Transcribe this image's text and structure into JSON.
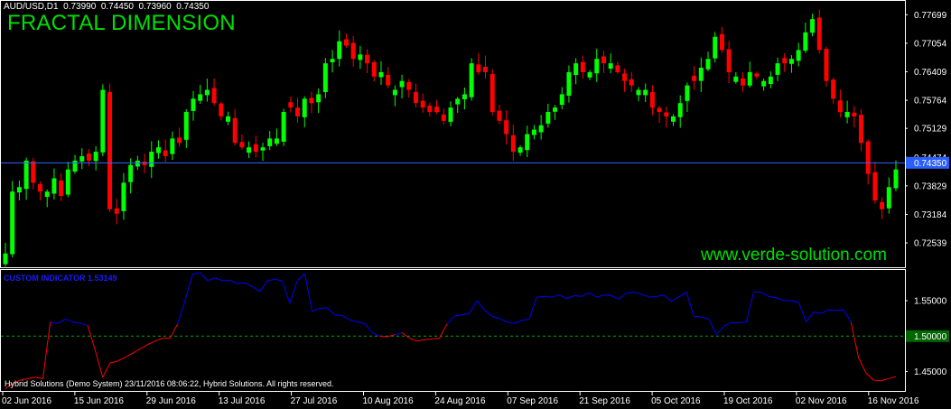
{
  "header": {
    "symbol": "AUD/USD,D1",
    "ohlc": "0.73990  0.74450  0.73960  0.74350",
    "title": "FRACTAL DIMENSION"
  },
  "watermark": "www.verde-solution.com",
  "indicator_label": "CUSTOM INDICATOR  1.53149",
  "footer": "Hybrid Solutions (Demo System) 23/11/2016 08:06:22, Hybrid Solutions. All rights reserved.",
  "colors": {
    "background": "#000000",
    "bull": "#00ff00",
    "bear": "#ff0000",
    "indicator_up": "#0000ff",
    "indicator_down": "#ff0000",
    "level_line": "#00aa00",
    "price_line": "#3366ff"
  },
  "chart_data": [
    {
      "type": "candlestick",
      "symbol": "AUD/USD",
      "timeframe": "D1",
      "price_axis_ticks": [
        "0.77699",
        "0.77054",
        "0.76409",
        "0.75764",
        "0.75129",
        "0.74474",
        "0.73829",
        "0.73184",
        "0.72539"
      ],
      "current_price": "0.74350",
      "ylim": [
        0.7205,
        0.7795
      ],
      "x_tick_labels": [
        "02 Jun 2016",
        "15 Jun 2016",
        "29 Jun 2016",
        "13 Jul 2016",
        "27 Jul 2016",
        "10 Aug 2016",
        "24 Aug 2016",
        "07 Sep 2016",
        "21 Sep 2016",
        "05 Oct 2016",
        "19 Oct 2016",
        "02 Nov 2016",
        "16 Nov 2016"
      ],
      "close": [
        0.723,
        0.737,
        0.738,
        0.744,
        0.739,
        0.737,
        0.737,
        0.74,
        0.736,
        0.742,
        0.744,
        0.745,
        0.744,
        0.746,
        0.76,
        0.733,
        0.732,
        0.739,
        0.743,
        0.744,
        0.743,
        0.746,
        0.747,
        0.745,
        0.749,
        0.748,
        0.755,
        0.758,
        0.759,
        0.76,
        0.757,
        0.754,
        0.754,
        0.748,
        0.747,
        0.747,
        0.746,
        0.747,
        0.749,
        0.749,
        0.755,
        0.756,
        0.754,
        0.758,
        0.757,
        0.759,
        0.766,
        0.767,
        0.771,
        0.77,
        0.767,
        0.768,
        0.766,
        0.763,
        0.764,
        0.761,
        0.76,
        0.762,
        0.76,
        0.757,
        0.756,
        0.755,
        0.755,
        0.753,
        0.756,
        0.758,
        0.759,
        0.766,
        0.764,
        0.764,
        0.755,
        0.753,
        0.75,
        0.746,
        0.747,
        0.75,
        0.751,
        0.752,
        0.755,
        0.756,
        0.759,
        0.764,
        0.766,
        0.764,
        0.764,
        0.767,
        0.766,
        0.766,
        0.764,
        0.762,
        0.761,
        0.76,
        0.76,
        0.756,
        0.755,
        0.754,
        0.754,
        0.757,
        0.761,
        0.762,
        0.765,
        0.767,
        0.772,
        0.769,
        0.764,
        0.763,
        0.761,
        0.764,
        0.763,
        0.762,
        0.763,
        0.766,
        0.766,
        0.767,
        0.769,
        0.773,
        0.776,
        0.769,
        0.762,
        0.758,
        0.755,
        0.755,
        0.754,
        0.748,
        0.741,
        0.735,
        0.733,
        0.738,
        0.742
      ],
      "indicator": {
        "name": "CUSTOM INDICATOR",
        "current_value": "1.53149",
        "ylim": [
          1.424,
          1.592
        ],
        "level": "1.50000",
        "axis_ticks": [
          "1.55000",
          "1.50000",
          "1.45000"
        ],
        "values": [
          1.426,
          1.433,
          1.438,
          1.44,
          1.442,
          1.44,
          1.52,
          1.518,
          1.524,
          1.52,
          1.518,
          1.515,
          1.48,
          1.442,
          1.462,
          1.465,
          1.47,
          1.476,
          1.482,
          1.488,
          1.493,
          1.497,
          1.497,
          1.517,
          1.55,
          1.587,
          1.59,
          1.578,
          1.582,
          1.578,
          1.579,
          1.574,
          1.575,
          1.57,
          1.563,
          1.578,
          1.58,
          1.578,
          1.546,
          1.578,
          1.588,
          1.535,
          1.539,
          1.54,
          1.53,
          1.529,
          1.523,
          1.52,
          1.518,
          1.505,
          1.5,
          1.499,
          1.502,
          1.505,
          1.497,
          1.493,
          1.495,
          1.496,
          1.497,
          1.517,
          1.528,
          1.53,
          1.532,
          1.55,
          1.537,
          1.528,
          1.525,
          1.52,
          1.518,
          1.522,
          1.524,
          1.555,
          1.556,
          1.555,
          1.558,
          1.553,
          1.557,
          1.556,
          1.561,
          1.555,
          1.558,
          1.557,
          1.552,
          1.561,
          1.562,
          1.559,
          1.555,
          1.556,
          1.558,
          1.549,
          1.555,
          1.562,
          1.528,
          1.527,
          1.524,
          1.502,
          1.514,
          1.519,
          1.519,
          1.52,
          1.562,
          1.562,
          1.556,
          1.554,
          1.55,
          1.55,
          1.548,
          1.52,
          1.534,
          1.532,
          1.537,
          1.536,
          1.537,
          1.52,
          1.47,
          1.448,
          1.438,
          1.437,
          1.44,
          1.443
        ],
        "color_down_after_index": 114
      }
    }
  ]
}
